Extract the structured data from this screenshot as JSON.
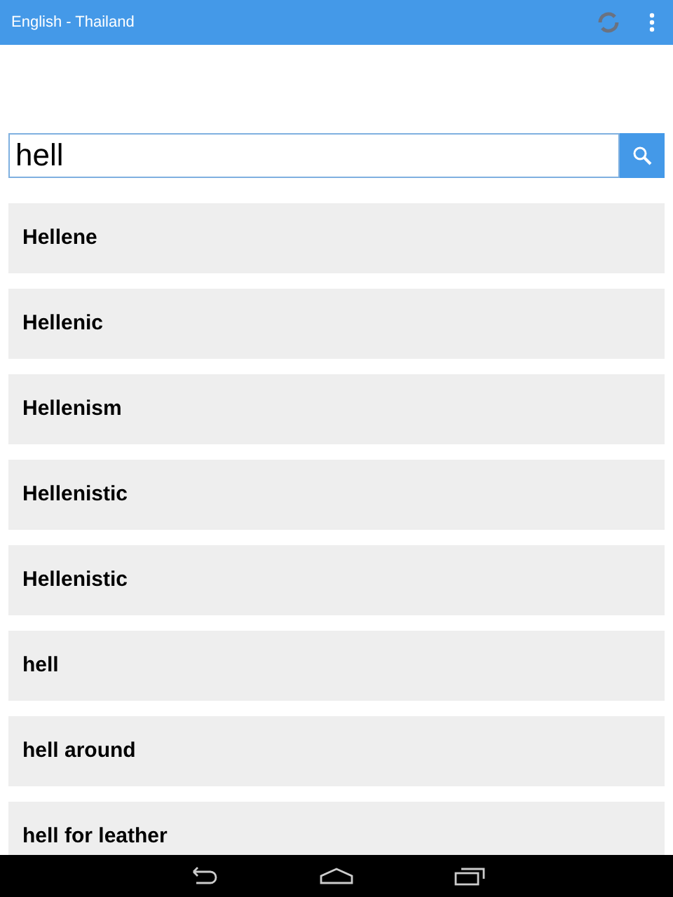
{
  "app_bar": {
    "title": "English - Thailand"
  },
  "search": {
    "value": "hell"
  },
  "results": [
    {
      "label": "Hellene"
    },
    {
      "label": "Hellenic"
    },
    {
      "label": "Hellenism"
    },
    {
      "label": "Hellenistic"
    },
    {
      "label": "Hellenistic"
    },
    {
      "label": "hell"
    },
    {
      "label": "hell around"
    },
    {
      "label": "hell for leather"
    }
  ]
}
